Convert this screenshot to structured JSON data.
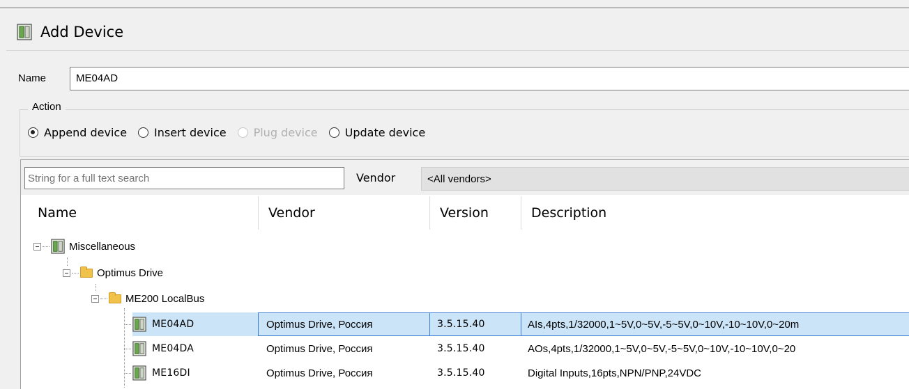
{
  "window": {
    "title": "Add Device"
  },
  "name_field": {
    "label": "Name",
    "value": "ME04AD"
  },
  "action": {
    "legend": "Action",
    "options": [
      {
        "label": "Append device",
        "checked": true,
        "disabled": false
      },
      {
        "label": "Insert device",
        "checked": false,
        "disabled": false
      },
      {
        "label": "Plug device",
        "checked": false,
        "disabled": true
      },
      {
        "label": "Update device",
        "checked": false,
        "disabled": false
      }
    ]
  },
  "search": {
    "placeholder": "String for a full text search",
    "vendor_label": "Vendor",
    "vendor_selected": "<All vendors>"
  },
  "columns": [
    "Name",
    "Vendor",
    "Version",
    "Description"
  ],
  "tree": {
    "root": "Miscellaneous",
    "group": "Optimus Drive",
    "subgroup": "ME200 LocalBus",
    "devices": [
      {
        "name": "ME04AD",
        "vendor": "Optimus Drive, Россия",
        "version": "3.5.15.40",
        "description": "AIs,4pts,1/32000,1~5V,0~5V,-5~5V,0~10V,-10~10V,0~20m",
        "selected": true
      },
      {
        "name": "ME04DA",
        "vendor": "Optimus Drive, Россия",
        "version": "3.5.15.40",
        "description": "AOs,4pts,1/32000,1~5V,0~5V,-5~5V,0~10V,-10~10V,0~20",
        "selected": false
      },
      {
        "name": "ME16DI",
        "vendor": "Optimus Drive, Россия",
        "version": "3.5.15.40",
        "description": "Digital Inputs,16pts,NPN/PNP,24VDC",
        "selected": false
      }
    ]
  },
  "colors": {
    "selection_bg": "#cce4f7",
    "selection_border": "#3b7fd1",
    "folder": "#f0c24b"
  }
}
